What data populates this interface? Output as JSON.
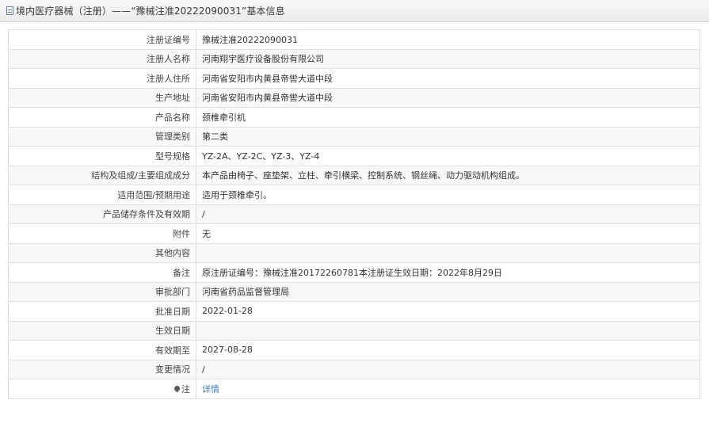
{
  "header": {
    "title": "境内医疗器械（注册）——“豫械注准20222090031”基本信息"
  },
  "rows": [
    {
      "label": "注册证编号",
      "value": "豫械注准20222090031"
    },
    {
      "label": "注册人名称",
      "value": "河南翔宇医疗设备股份有限公司"
    },
    {
      "label": "注册人住所",
      "value": "河南省安阳市内黄县帝喾大道中段"
    },
    {
      "label": "生产地址",
      "value": "河南省安阳市内黄县帝喾大道中段"
    },
    {
      "label": "产品名称",
      "value": "颈椎牵引机"
    },
    {
      "label": "管理类别",
      "value": "第二类"
    },
    {
      "label": "型号规格",
      "value": "YZ-2A、YZ-2C、YZ-3、YZ-4"
    },
    {
      "label": "结构及组成/主要组成成分",
      "value": "本产品由椅子、座垫架、立柱、牵引横梁、控制系统、钢丝绳、动力驱动机构组成。"
    },
    {
      "label": "适用范围/预期用途",
      "value": "适用于颈椎牵引。"
    },
    {
      "label": "产品储存条件及有效期",
      "value": "/"
    },
    {
      "label": "附件",
      "value": "无"
    },
    {
      "label": "其他内容",
      "value": ""
    },
    {
      "label": "备注",
      "value": "原注册证编号：豫械注准20172260781本注册证生效日期：2022年8月29日"
    },
    {
      "label": "审批部门",
      "value": "河南省药品监督管理局"
    },
    {
      "label": "批准日期",
      "value": "2022-01-28"
    },
    {
      "label": "生效日期",
      "value": ""
    },
    {
      "label": "有效期至",
      "value": "2027-08-28"
    },
    {
      "label": "变更情况",
      "value": "/"
    },
    {
      "label": "注",
      "value": "详情"
    }
  ],
  "icons": {
    "title": "document-icon",
    "note": "pin-icon"
  },
  "colors": {
    "link": "#3c7cc5",
    "border": "#dedede"
  }
}
